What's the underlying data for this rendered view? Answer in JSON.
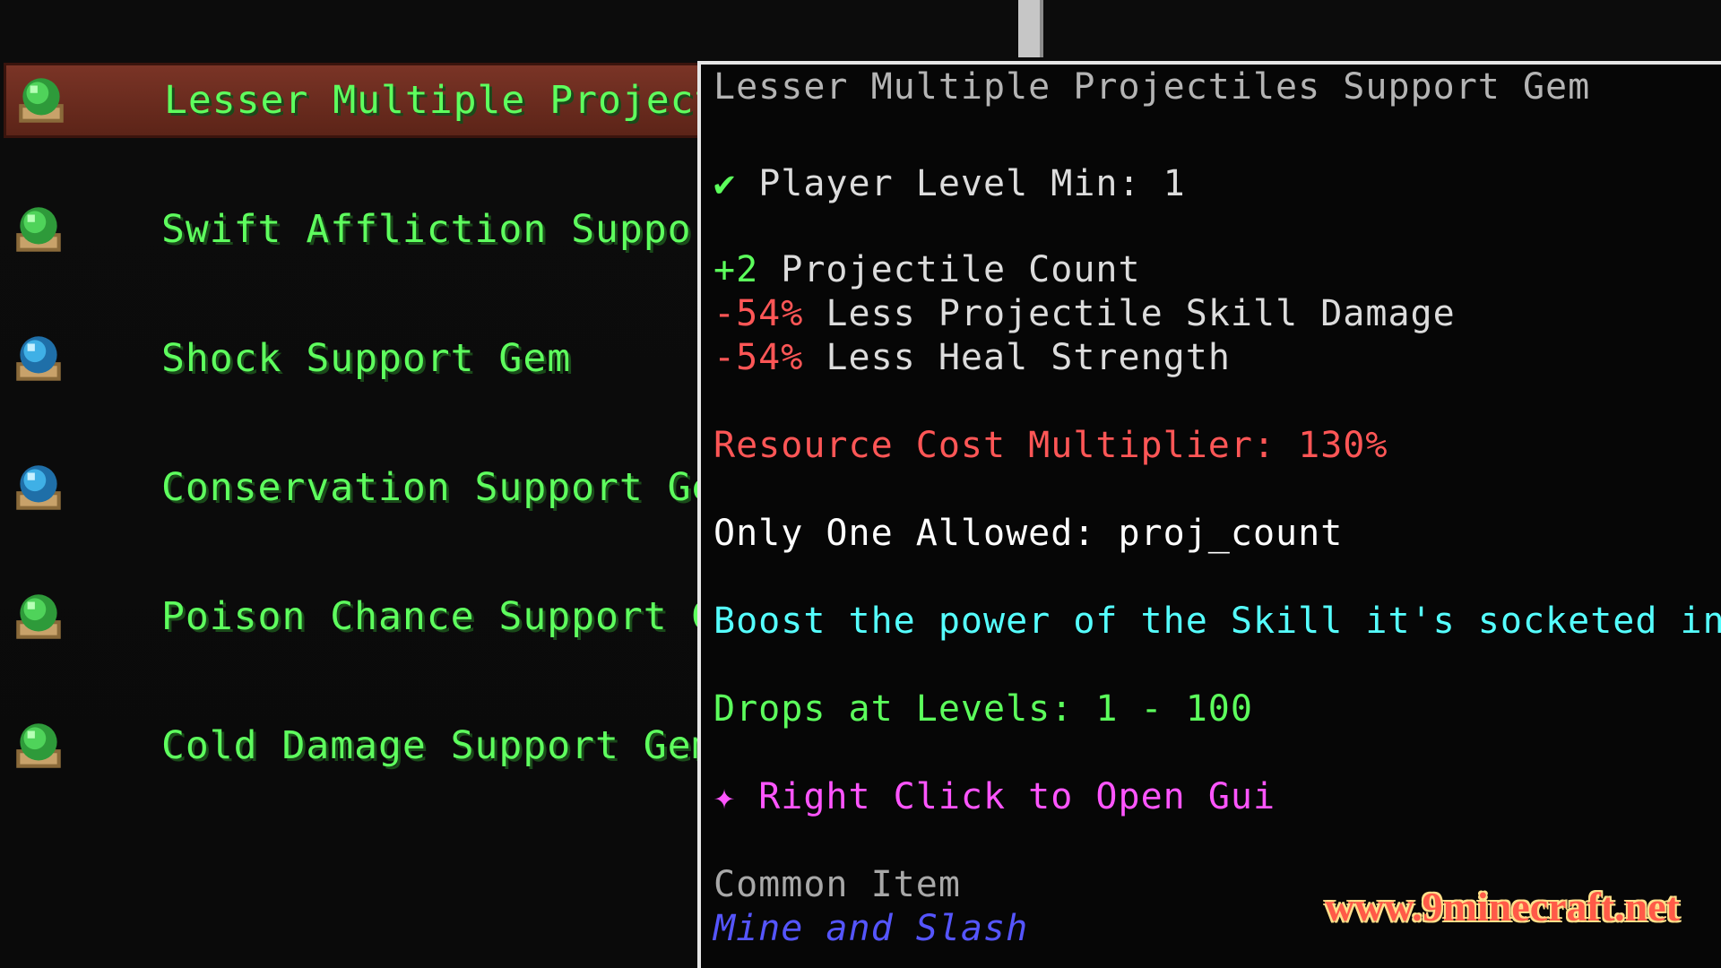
{
  "gem_list": {
    "items": [
      {
        "label": "Lesser Multiple Projectiles Support Gem",
        "icon": "green-gem-icon",
        "selected": true
      },
      {
        "label": "Swift Affliction Support Gem",
        "icon": "green-gem-icon",
        "selected": false
      },
      {
        "label": "Shock Support Gem",
        "icon": "blue-gem-icon",
        "selected": false
      },
      {
        "label": "Conservation Support Gem",
        "icon": "blue-gem-icon",
        "selected": false
      },
      {
        "label": "Poison Chance Support Gem",
        "icon": "green-gem-icon",
        "selected": false
      },
      {
        "label": "Cold Damage Support Gem",
        "icon": "green-gem-icon",
        "selected": false
      }
    ]
  },
  "tooltip": {
    "title": "Lesser Multiple Projectiles Support Gem",
    "requirement_check": "✔",
    "requirement": "Player Level Min: 1",
    "stats": [
      {
        "value": "+2",
        "text": "Projectile Count"
      },
      {
        "value": "-54%",
        "text": "Less Projectile Skill Damage"
      },
      {
        "value": "-54%",
        "text": "Less Heal Strength"
      }
    ],
    "resource_cost": "Resource Cost Multiplier: 130%",
    "only_one": "Only One Allowed: proj_count",
    "description": "Boost the power of the Skill it's socketed into.",
    "drops": "Drops at Levels: 1 - 100",
    "right_click_marker": "✦",
    "right_click": "Right Click to Open Gui",
    "rarity": "Common Item",
    "mod_name": "Mine and Slash"
  },
  "watermark": "www.9minecraft.net",
  "colors": {
    "list_label": "#5eff5e",
    "selected_row": "#7a3426",
    "stat_positive": "#5cff5c",
    "stat_negative": "#ff5656",
    "description": "#55ffff",
    "right_click": "#ff55ff",
    "mod_name": "#5555ff"
  }
}
